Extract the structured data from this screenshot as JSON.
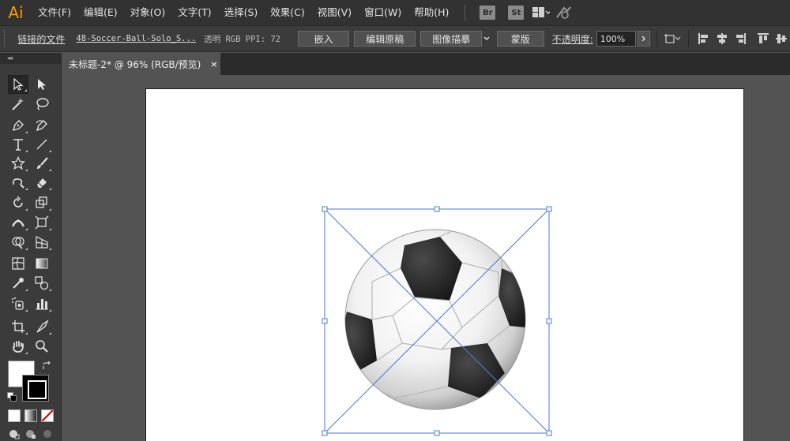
{
  "app": {
    "logo": "Ai"
  },
  "menu": {
    "items": [
      "文件(F)",
      "编辑(E)",
      "对象(O)",
      "文字(T)",
      "选择(S)",
      "效果(C)",
      "视图(V)",
      "窗口(W)",
      "帮助(H)"
    ],
    "bridge_badge": "Br",
    "stock_badge": "St"
  },
  "control_bar": {
    "linked_file_label": "链接的文件",
    "file_name": "48-Soccer-Ball-Solo_S...",
    "image_info": "透明 RGB  PPI: 72",
    "embed_button": "嵌入",
    "edit_original_button": "编辑原稿",
    "image_trace_button": "图像描摹",
    "mask_button": "蒙版",
    "opacity_label": "不透明度:",
    "opacity_value": "100%"
  },
  "toolbar": {
    "collapse_label": "◂◂"
  },
  "document": {
    "tab_title": "未标题-2* @ 96% (RGB/预览)",
    "close_glyph": "×"
  },
  "colors": {
    "menubar_bg": "#323232",
    "panel_bg": "#3b3b3b",
    "canvas_bg": "#535353",
    "logo": "#ff9a00",
    "selection": "#4a78d6"
  },
  "icons": [
    "selection-tool-icon",
    "direct-selection-tool-icon",
    "magic-wand-icon",
    "lasso-icon",
    "pen-icon",
    "curvature-icon",
    "type-icon",
    "line-segment-icon",
    "star-icon",
    "paintbrush-icon",
    "shaper-icon",
    "eraser-icon",
    "rotate-icon",
    "scale-icon",
    "width-icon",
    "free-transform-icon",
    "shape-builder-icon",
    "perspective-grid-icon",
    "mesh-icon",
    "gradient-icon",
    "eyedropper-icon",
    "blend-icon",
    "symbol-sprayer-icon",
    "column-graph-icon",
    "artboard-icon",
    "slice-icon",
    "hand-icon",
    "zoom-icon"
  ]
}
